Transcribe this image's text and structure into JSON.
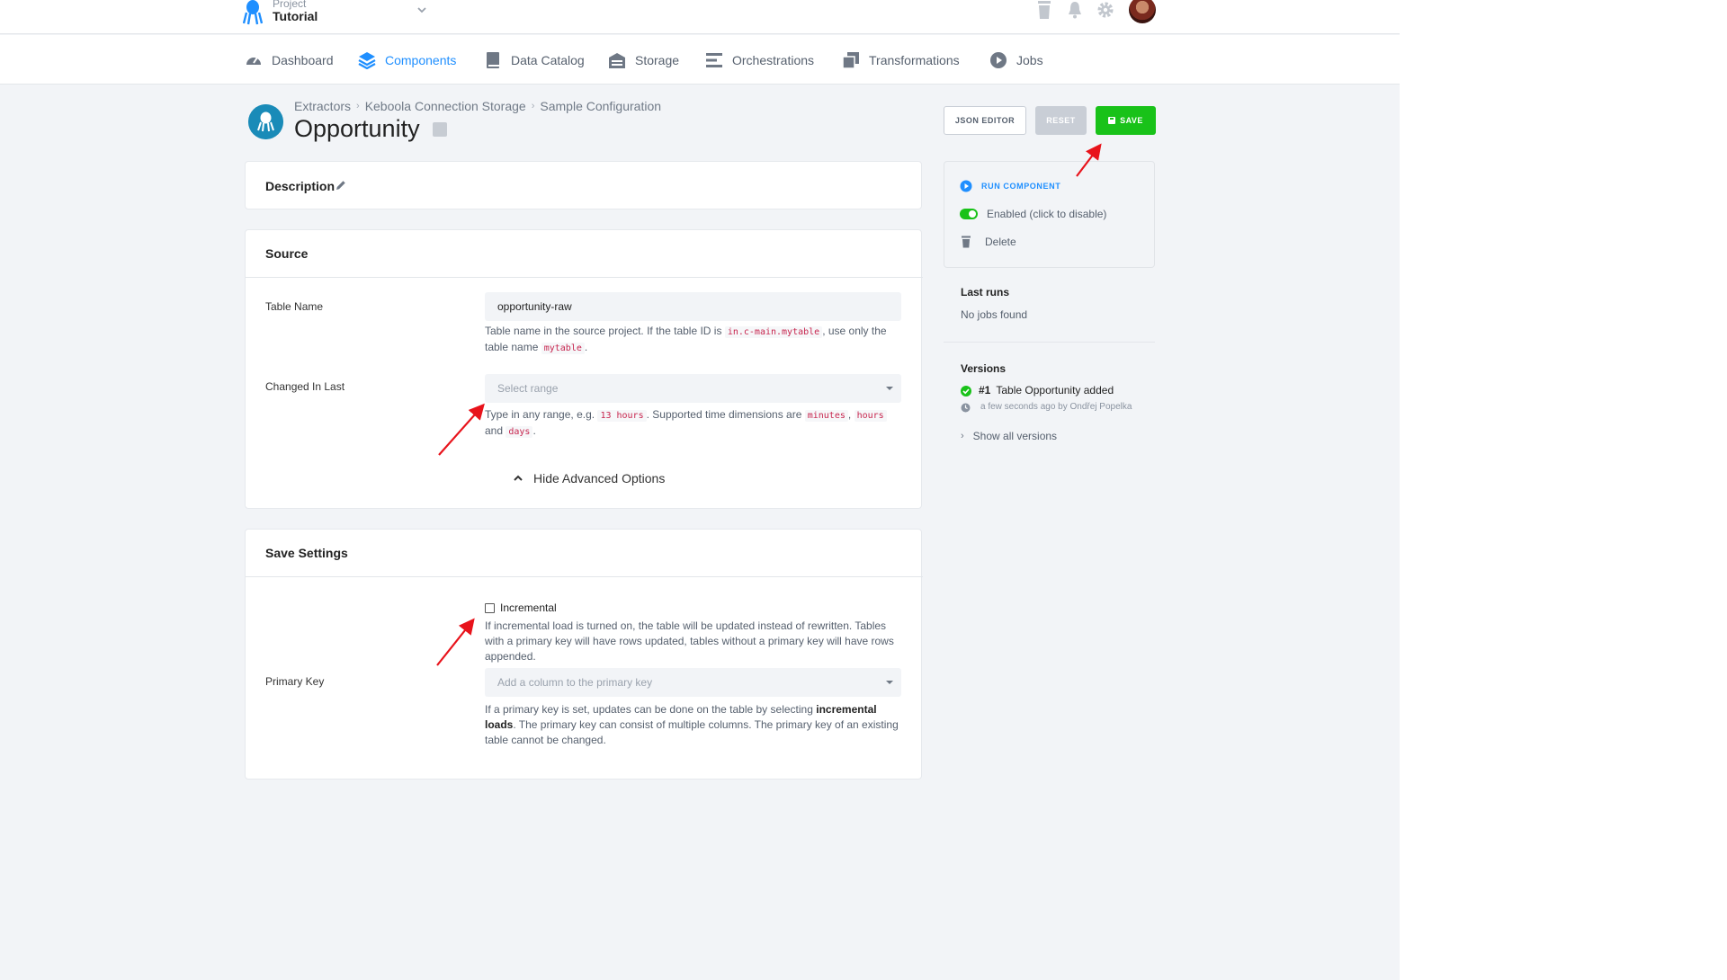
{
  "project": {
    "label": "Project",
    "name": "Tutorial"
  },
  "nav": [
    {
      "label": "Dashboard",
      "icon": "dashboard-gauge-icon"
    },
    {
      "label": "Components",
      "icon": "layers-icon",
      "active": true
    },
    {
      "label": "Data Catalog",
      "icon": "book-icon"
    },
    {
      "label": "Storage",
      "icon": "warehouse-icon"
    },
    {
      "label": "Orchestrations",
      "icon": "bars-icon"
    },
    {
      "label": "Transformations",
      "icon": "copy-icon"
    },
    {
      "label": "Jobs",
      "icon": "play-circle-icon"
    }
  ],
  "breadcrumb": [
    "Extractors",
    "Keboola Connection Storage",
    "Sample Configuration"
  ],
  "title": "Opportunity",
  "buttons": {
    "json_editor": "JSON EDITOR",
    "reset": "RESET",
    "save": "SAVE"
  },
  "description": {
    "label": "Description"
  },
  "source": {
    "title": "Source",
    "table_name": {
      "label": "Table Name",
      "value": "opportunity-raw",
      "help_before": "Table name in the source project. If the table ID is",
      "help_code1": "in.c-main.mytable",
      "help_mid": ", use only the table name",
      "help_code2": "mytable",
      "help_after": "."
    },
    "changed_in_last": {
      "label": "Changed In Last",
      "placeholder": "Select range",
      "help_before": "Type in any range, e.g.",
      "help_code1": "13 hours",
      "help_mid": ". Supported time dimensions are",
      "help_code2": "minutes",
      "help_sep": ",",
      "help_code3": "hours",
      "help_and": "and",
      "help_code4": "days",
      "help_after": "."
    },
    "advanced_toggle": "Hide Advanced Options"
  },
  "save_settings": {
    "title": "Save Settings",
    "incremental": {
      "label": "Incremental",
      "checked": false,
      "help": "If incremental load is turned on, the table will be updated instead of rewritten. Tables with a primary key will have rows updated, tables without a primary key will have rows appended."
    },
    "primary_key": {
      "label": "Primary Key",
      "placeholder": "Add a column to the primary key",
      "help_before": "If a primary key is set, updates can be done on the table by selecting",
      "help_bold": "incremental loads",
      "help_after": ". The primary key can consist of multiple columns. The primary key of an existing table cannot be changed."
    }
  },
  "sidebar": {
    "run": "RUN COMPONENT",
    "enabled": "Enabled (click to disable)",
    "delete": "Delete",
    "last_runs_title": "Last runs",
    "last_runs_empty": "No jobs found",
    "versions_title": "Versions",
    "version_number": "#1",
    "version_desc": "Table Opportunity added",
    "version_time": "a few seconds ago by Ondřej Popelka",
    "show_all": "Show all versions"
  },
  "colors": {
    "accent": "#1f8fff",
    "save": "#19c219",
    "annotation": "#e8131b"
  }
}
